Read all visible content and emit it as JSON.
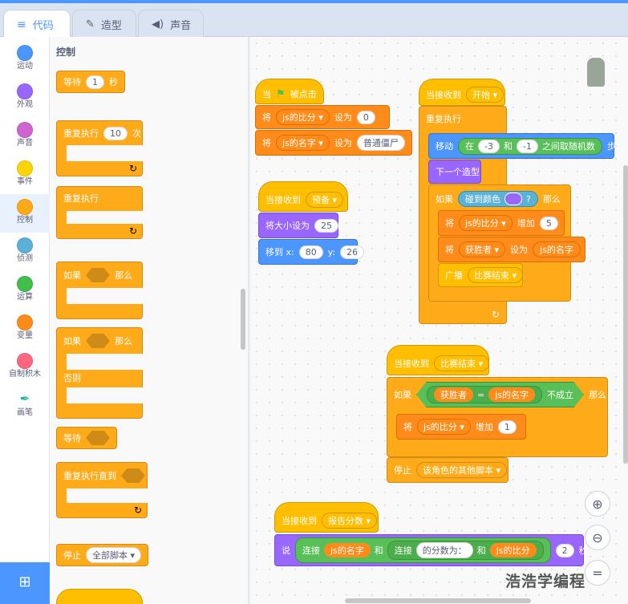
{
  "tabs": [
    {
      "label": "代码"
    },
    {
      "label": "造型"
    },
    {
      "label": "声音"
    }
  ],
  "categories": [
    {
      "label": "运动",
      "color": "#4c97ff"
    },
    {
      "label": "外观",
      "color": "#9966ff"
    },
    {
      "label": "声音",
      "color": "#cf63cf"
    },
    {
      "label": "事件",
      "color": "#ffd500"
    },
    {
      "label": "控制",
      "color": "#ffab19"
    },
    {
      "label": "侦测",
      "color": "#5cb1d6"
    },
    {
      "label": "运算",
      "color": "#40bf4a"
    },
    {
      "label": "变量",
      "color": "#ff8c1a"
    },
    {
      "label": "自制积木",
      "color": "#ff6680"
    },
    {
      "label": "画笔",
      "color": "#ffffff"
    }
  ],
  "palette": {
    "title": "控制",
    "wait": {
      "label": "等待",
      "value": "1",
      "unit": "秒"
    },
    "repeat": {
      "label": "重复执行",
      "value": "10",
      "unit": "次"
    },
    "forever": {
      "label": "重复执行"
    },
    "if_then": {
      "label": "如果",
      "then": "那么"
    },
    "if_else": {
      "label": "如果",
      "then": "那么",
      "else": "否则"
    },
    "wait_until": {
      "label": "等待"
    },
    "repeat_until": {
      "label": "重复执行直到"
    },
    "stop": {
      "label": "停止",
      "option": "全部脚本"
    }
  },
  "scripts": {
    "flag": {
      "when": "当",
      "clicked": "被点击",
      "set1": {
        "label": "将",
        "var": "js的比分",
        "to": "设为",
        "value": "0"
      },
      "set2": {
        "label": "将",
        "var": "js的名字",
        "to": "设为",
        "value": "普通僵尸"
      }
    },
    "ready": {
      "when": "当接收到",
      "msg": "预备",
      "size_label": "将大小设为",
      "size": "25",
      "goto": "移到 x:",
      "x": "80",
      "y_label": "y:",
      "y": "26"
    },
    "start": {
      "when": "当接收到",
      "msg": "开始",
      "forever": "重复执行",
      "move": "移动",
      "in": "在",
      "a": "-3",
      "and": "和",
      "b": "-1",
      "rand": "之间取随机数",
      "steps": "步",
      "next": "下一个造型",
      "if": "如果",
      "touch": "碰到颜色",
      "q": "?",
      "then": "那么",
      "change": {
        "label": "将",
        "var": "js的比分",
        "op": "增加",
        "value": "5"
      },
      "set": {
        "label": "将",
        "var": "获胜者",
        "op": "设为",
        "value": "js的名字"
      },
      "broadcast": "广播",
      "bmsg": "比赛结束"
    },
    "end": {
      "when": "当接收到",
      "msg": "比赛结束",
      "if": "如果",
      "winner": "获胜者",
      "eq": "=",
      "name": "js的名字",
      "not": "不成立",
      "then": "那么",
      "change": {
        "label": "将",
        "var": "js的比分",
        "op": "增加",
        "value": "1"
      },
      "stop": "停止",
      "stop_opt": "该角色的其他脚本"
    },
    "report": {
      "when": "当接收到",
      "msg": "报告分数",
      "say": "说",
      "join1": "连接",
      "name": "js的名字",
      "and1": "和",
      "join2": "连接",
      "score_text": "的分数为：",
      "and2": "和",
      "score": "js的比分",
      "secs": "2",
      "unit": "秒"
    }
  },
  "watermark": "浩浩学编程"
}
